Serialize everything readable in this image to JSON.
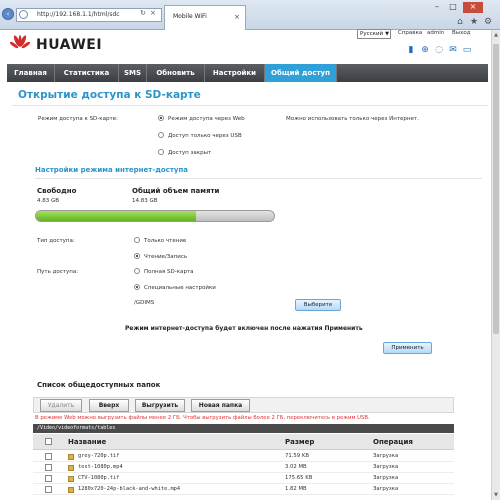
{
  "browser": {
    "address": "http://192.168.1.1/html/sdc",
    "tab_title": "Mobile WiFi",
    "tab_close": "×",
    "min": "–",
    "max": "□",
    "close": "×"
  },
  "header": {
    "brand": "HUAWEI",
    "language": "Русский",
    "links": [
      "Справка",
      "admin",
      "Выход"
    ]
  },
  "menu": [
    "Главная",
    "Статистика",
    "SMS",
    "Обновить",
    "Настройки",
    "Общий доступ"
  ],
  "page_title": "Открытие доступа к SD-карте",
  "access_mode": {
    "label": "Режим доступа к SD-карте:",
    "options": [
      "Режим доступа через Web",
      "Доступ только через USB",
      "Доступ закрыт"
    ],
    "selected": 0,
    "note": "Можно использовать только через Интернет."
  },
  "section_title": "Настройки режима интернет-доступа",
  "storage": {
    "free_label": "Свободно",
    "free_value": "4.83 GB",
    "total_label": "Общий объем памяти",
    "total_value": "14.83 GB",
    "used_fraction": 0.674
  },
  "access_type": {
    "label": "Тип доступа:",
    "options": [
      "Только чтение",
      "Чтение/Запись"
    ],
    "selected": 1
  },
  "access_path": {
    "label": "Путь доступа:",
    "options": [
      "Полная SD-карта",
      "Специальные настройки"
    ],
    "selected": 1,
    "value": "/GDIMS",
    "browse_button": "Выберите"
  },
  "apply_note": "Режим интернет-доступа будет включен после нажатия Применить",
  "apply_button": "Применить",
  "shares": {
    "title": "Список общедоступных папок",
    "buttons": [
      "Удалить",
      "Вверх",
      "Выгрузить",
      "Новая папка"
    ],
    "warning": "В режиме Web можно выгрузить файлы менее 2 ГБ. Чтобы выгрузить файлы более 2 ГБ, переключитесь в режим USB.",
    "path": "/Video/videoformats/tables",
    "columns": [
      "Название",
      "Размер",
      "Операция"
    ],
    "rows": [
      {
        "name": "grey-720p.tif",
        "size": "71.59 KB",
        "op": "Загрузка"
      },
      {
        "name": "test-1080p.mp4",
        "size": "3.02 MB",
        "op": "Загрузка"
      },
      {
        "name": "CTV-1080p.tif",
        "size": "175.65 KB",
        "op": "Загрузка"
      },
      {
        "name": "1280x720-24p-black-and-white.mp4",
        "size": "1.82 MB",
        "op": "Загрузка"
      }
    ]
  }
}
